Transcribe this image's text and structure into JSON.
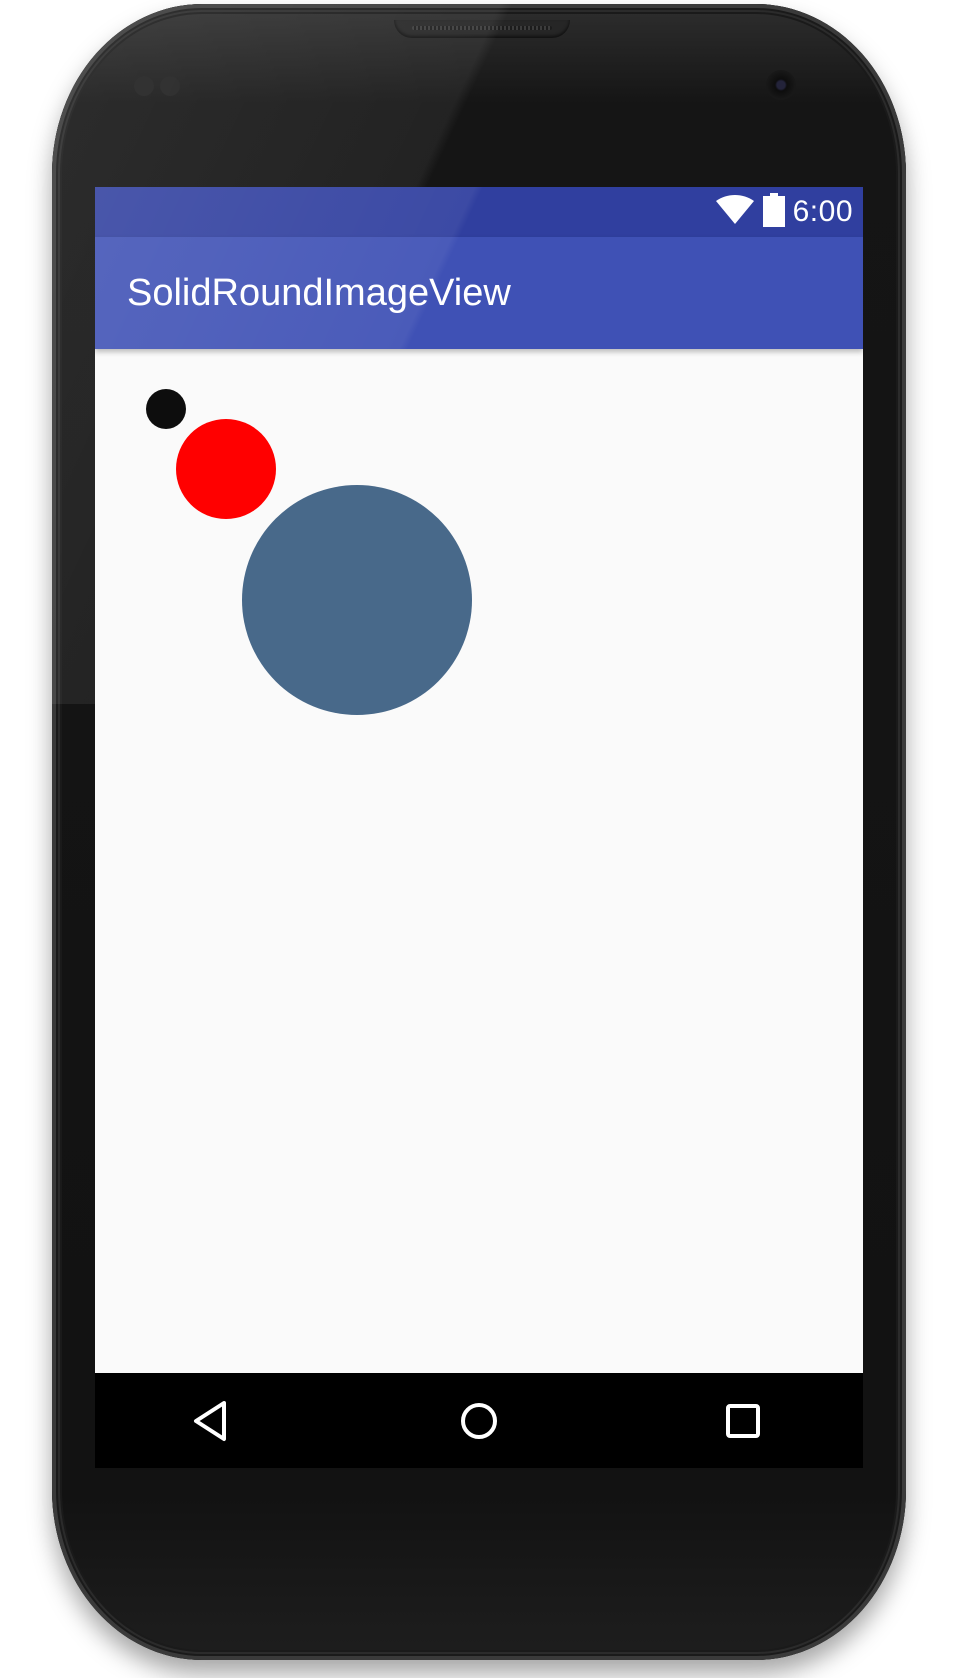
{
  "status_bar": {
    "time": "6:00",
    "icons": [
      "wifi-icon",
      "battery-icon"
    ]
  },
  "app_bar": {
    "title": "SolidRoundImageView"
  },
  "content": {
    "round_images": [
      {
        "name": "small",
        "color": "#0d0d0d"
      },
      {
        "name": "medium",
        "color": "#ff0000"
      },
      {
        "name": "large",
        "color": "#48698a"
      }
    ]
  },
  "nav_bar": {
    "buttons": [
      "back-icon",
      "home-icon",
      "recents-icon"
    ]
  },
  "colors": {
    "status_bar": "#303f9f",
    "app_bar": "#3f51b5",
    "background": "#fafafa"
  }
}
